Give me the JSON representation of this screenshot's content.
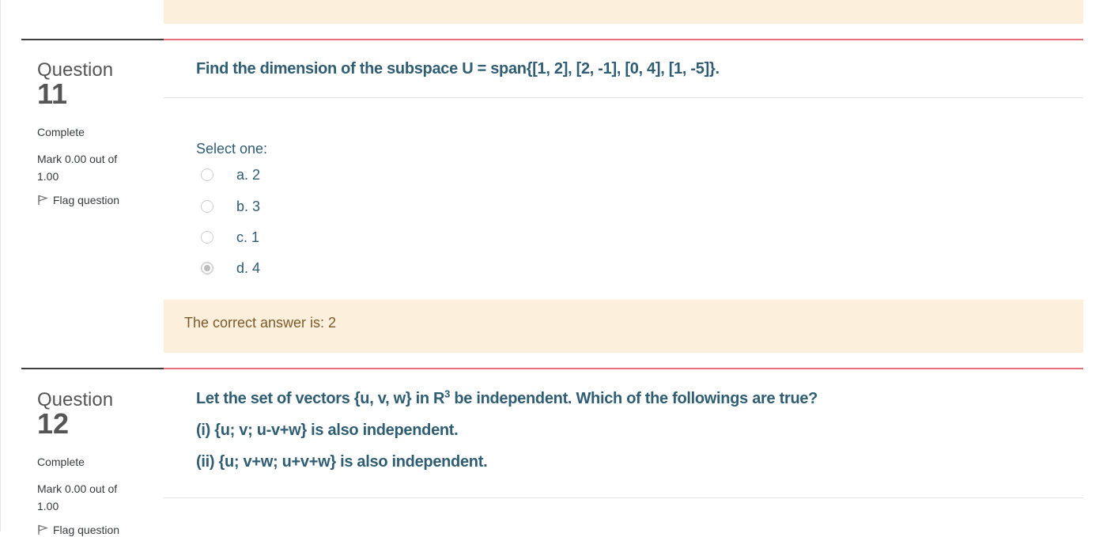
{
  "questions": [
    {
      "label": "Question",
      "number": "11",
      "state": "Complete",
      "grade": "Mark 0.00 out of 1.00",
      "flag_label": "Flag question",
      "text": "Find the dimension of the subspace U = span{[1, 2], [2, -1], [0, 4], [1, -5]}.",
      "prompt": "Select one:",
      "options": [
        {
          "label": "a. 2",
          "checked": false
        },
        {
          "label": "b. 3",
          "checked": false
        },
        {
          "label": "c. 1",
          "checked": false
        },
        {
          "label": "d. 4",
          "checked": true
        }
      ],
      "feedback": "The correct answer is: 2"
    },
    {
      "label": "Question",
      "number": "12",
      "state": "Complete",
      "grade": "Mark 0.00 out of 1.00",
      "flag_label": "Flag question",
      "text_lines": [
        {
          "before": "Let the set of vectors {u, v, w} in R",
          "sup": "3",
          "after": " be independent. Which of the followings are true?"
        },
        {
          "text": "(i) {u; v; u-v+w} is also independent."
        },
        {
          "text": "(ii) {u; v+w; u+v+w} is also independent."
        }
      ]
    }
  ],
  "colors": {
    "feedback_bg": "#fcefdc",
    "accent_line": "#e8717c",
    "question_text": "#2f5d73"
  }
}
